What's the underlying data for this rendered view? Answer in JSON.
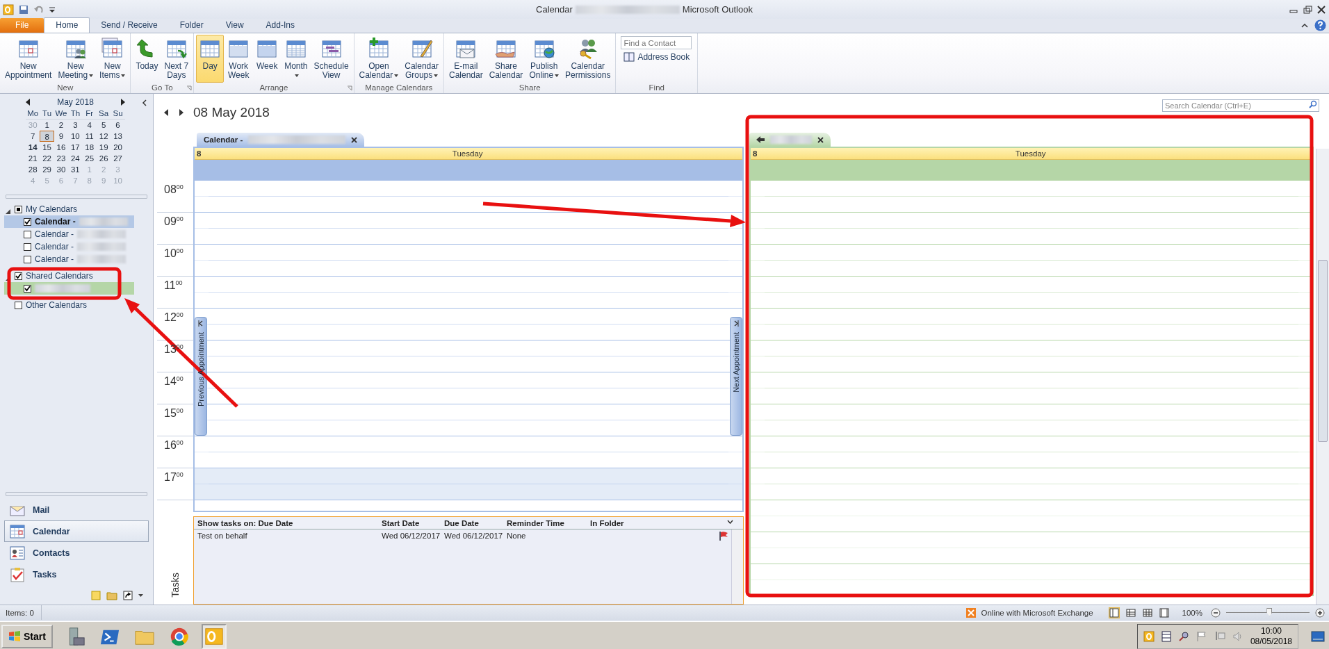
{
  "title_bar": {
    "title": "Calendar",
    "title_redacted": true,
    "app": "Microsoft Outlook"
  },
  "ribbon_tabs": [
    {
      "label": "File",
      "kind": "file",
      "selected": false
    },
    {
      "label": "Home",
      "kind": "tab",
      "selected": true
    },
    {
      "label": "Send / Receive",
      "kind": "tab",
      "selected": false
    },
    {
      "label": "Folder",
      "kind": "tab",
      "selected": false
    },
    {
      "label": "View",
      "kind": "tab",
      "selected": false
    },
    {
      "label": "Add-Ins",
      "kind": "tab",
      "selected": false
    }
  ],
  "ribbon_groups": [
    {
      "label": "New",
      "launcher": false,
      "buttons": [
        {
          "lines": [
            "New",
            "Appointment"
          ],
          "kind": "appointment",
          "menu": false,
          "selected": false
        },
        {
          "lines": [
            "New",
            "Meeting"
          ],
          "kind": "meeting",
          "menu": true,
          "selected": false
        },
        {
          "lines": [
            "New",
            "Items"
          ],
          "kind": "items",
          "menu": true,
          "selected": false
        }
      ]
    },
    {
      "label": "Go To",
      "launcher": true,
      "buttons": [
        {
          "lines": [
            "Today"
          ],
          "kind": "today",
          "menu": false,
          "selected": false
        },
        {
          "lines": [
            "Next 7",
            "Days"
          ],
          "kind": "next7",
          "menu": false,
          "selected": false
        }
      ]
    },
    {
      "label": "Arrange",
      "launcher": true,
      "buttons": [
        {
          "lines": [
            "Day"
          ],
          "kind": "day",
          "menu": false,
          "selected": true
        },
        {
          "lines": [
            "Work",
            "Week"
          ],
          "kind": "workweek",
          "menu": false,
          "selected": false
        },
        {
          "lines": [
            "Week"
          ],
          "kind": "week",
          "menu": false,
          "selected": false
        },
        {
          "lines": [
            "Month"
          ],
          "kind": "month",
          "menu": true,
          "selected": false
        },
        {
          "lines": [
            "Schedule",
            "View"
          ],
          "kind": "schedule",
          "menu": false,
          "selected": false
        }
      ]
    },
    {
      "label": "Manage Calendars",
      "launcher": false,
      "buttons": [
        {
          "lines": [
            "Open",
            "Calendar"
          ],
          "kind": "open",
          "menu": true,
          "selected": false
        },
        {
          "lines": [
            "Calendar",
            "Groups"
          ],
          "kind": "groups",
          "menu": true,
          "selected": false
        }
      ]
    },
    {
      "label": "Share",
      "launcher": false,
      "buttons": [
        {
          "lines": [
            "E-mail",
            "Calendar"
          ],
          "kind": "email",
          "menu": false,
          "selected": false
        },
        {
          "lines": [
            "Share",
            "Calendar"
          ],
          "kind": "share",
          "menu": false,
          "selected": false
        },
        {
          "lines": [
            "Publish",
            "Online"
          ],
          "kind": "publish",
          "menu": true,
          "selected": false
        },
        {
          "lines": [
            "Calendar",
            "Permissions"
          ],
          "kind": "permissions",
          "menu": false,
          "selected": false
        }
      ]
    },
    {
      "label": "Find",
      "launcher": false,
      "find": {
        "placeholder": "Find a Contact",
        "link": "Address Book"
      }
    }
  ],
  "mini_calendar": {
    "month": "May 2018",
    "weekdays": [
      "Mo",
      "Tu",
      "We",
      "Th",
      "Fr",
      "Sa",
      "Su"
    ],
    "weeks": [
      [
        {
          "day": "30",
          "other_month": true,
          "selected": false,
          "bold": false
        },
        {
          "day": "1",
          "other_month": false,
          "selected": false,
          "bold": false
        },
        {
          "day": "2",
          "other_month": false,
          "selected": false,
          "bold": false
        },
        {
          "day": "3",
          "other_month": false,
          "selected": false,
          "bold": false
        },
        {
          "day": "4",
          "other_month": false,
          "selected": false,
          "bold": false
        },
        {
          "day": "5",
          "other_month": false,
          "selected": false,
          "bold": false
        },
        {
          "day": "6",
          "other_month": false,
          "selected": false,
          "bold": false
        }
      ],
      [
        {
          "day": "7",
          "other_month": false,
          "selected": false,
          "bold": false
        },
        {
          "day": "8",
          "other_month": false,
          "selected": true,
          "bold": false
        },
        {
          "day": "9",
          "other_month": false,
          "selected": false,
          "bold": false
        },
        {
          "day": "10",
          "other_month": false,
          "selected": false,
          "bold": false
        },
        {
          "day": "11",
          "other_month": false,
          "selected": false,
          "bold": false
        },
        {
          "day": "12",
          "other_month": false,
          "selected": false,
          "bold": false
        },
        {
          "day": "13",
          "other_month": false,
          "selected": false,
          "bold": false
        }
      ],
      [
        {
          "day": "14",
          "other_month": false,
          "selected": false,
          "bold": true
        },
        {
          "day": "15",
          "other_month": false,
          "selected": false,
          "bold": false
        },
        {
          "day": "16",
          "other_month": false,
          "selected": false,
          "bold": false
        },
        {
          "day": "17",
          "other_month": false,
          "selected": false,
          "bold": false
        },
        {
          "day": "18",
          "other_month": false,
          "selected": false,
          "bold": false
        },
        {
          "day": "19",
          "other_month": false,
          "selected": false,
          "bold": false
        },
        {
          "day": "20",
          "other_month": false,
          "selected": false,
          "bold": false
        }
      ],
      [
        {
          "day": "21",
          "other_month": false,
          "selected": false,
          "bold": false
        },
        {
          "day": "22",
          "other_month": false,
          "selected": false,
          "bold": false
        },
        {
          "day": "23",
          "other_month": false,
          "selected": false,
          "bold": false
        },
        {
          "day": "24",
          "other_month": false,
          "selected": false,
          "bold": false
        },
        {
          "day": "25",
          "other_month": false,
          "selected": false,
          "bold": false
        },
        {
          "day": "26",
          "other_month": false,
          "selected": false,
          "bold": false
        },
        {
          "day": "27",
          "other_month": false,
          "selected": false,
          "bold": false
        }
      ],
      [
        {
          "day": "28",
          "other_month": false,
          "selected": false,
          "bold": false
        },
        {
          "day": "29",
          "other_month": false,
          "selected": false,
          "bold": false
        },
        {
          "day": "30",
          "other_month": false,
          "selected": false,
          "bold": false
        },
        {
          "day": "31",
          "other_month": false,
          "selected": false,
          "bold": false
        },
        {
          "day": "1",
          "other_month": true,
          "selected": false,
          "bold": false
        },
        {
          "day": "2",
          "other_month": true,
          "selected": false,
          "bold": false
        },
        {
          "day": "3",
          "other_month": true,
          "selected": false,
          "bold": false
        }
      ],
      [
        {
          "day": "4",
          "other_month": true,
          "selected": false,
          "bold": false
        },
        {
          "day": "5",
          "other_month": true,
          "selected": false,
          "bold": false
        },
        {
          "day": "6",
          "other_month": true,
          "selected": false,
          "bold": false
        },
        {
          "day": "7",
          "other_month": true,
          "selected": false,
          "bold": false
        },
        {
          "day": "8",
          "other_month": true,
          "selected": false,
          "bold": false
        },
        {
          "day": "9",
          "other_month": true,
          "selected": false,
          "bold": false
        },
        {
          "day": "10",
          "other_month": true,
          "selected": false,
          "bold": false
        }
      ]
    ]
  },
  "calendar_groups": [
    {
      "label": "My Calendars",
      "checked": true,
      "partial": true,
      "expanded": true,
      "children": [
        {
          "label": "Calendar -",
          "name_redacted": true,
          "checked": true,
          "color": "#b4c8e6"
        },
        {
          "label": "Calendar -",
          "name_redacted": true,
          "checked": false
        },
        {
          "label": "Calendar -",
          "name_redacted": true,
          "checked": false
        },
        {
          "label": "Calendar -",
          "name_redacted": true,
          "checked": false
        }
      ]
    },
    {
      "label": "Shared Calendars",
      "checked": true,
      "partial": false,
      "expanded": true,
      "children": [
        {
          "name_redacted": true,
          "checked": true,
          "color": "#b5d6a7"
        }
      ]
    },
    {
      "label": "Other Calendars",
      "checked": false,
      "partial": false,
      "expanded": false
    }
  ],
  "navigation": [
    {
      "label": "Mail",
      "kind": "mail",
      "selected": false
    },
    {
      "label": "Calendar",
      "kind": "calendar",
      "selected": true
    },
    {
      "label": "Contacts",
      "kind": "contacts",
      "selected": false
    },
    {
      "label": "Tasks",
      "kind": "tasks",
      "selected": false
    }
  ],
  "calendar": {
    "date_title": "08 May 2018",
    "search": {
      "placeholder": "Search Calendar (Ctrl+E)"
    },
    "hours": [
      {
        "label": "08$^{00}$",
        "work": true
      },
      {
        "label": "09$^{00}$",
        "work": true
      },
      {
        "label": "10$^{00}$",
        "work": true
      },
      {
        "label": "11$^{00}$",
        "work": true
      },
      {
        "label": "12$^{00}$",
        "work": true
      },
      {
        "label": "13$^{00}$",
        "work": true
      },
      {
        "label": "14$^{00}$",
        "work": true
      },
      {
        "label": "15$^{00}$",
        "work": true
      },
      {
        "label": "16$^{00}$",
        "work": true
      },
      {
        "label": "17$^{00}$",
        "work": false
      }
    ],
    "panes": [
      {
        "kind": "own",
        "tab": "Calendar -",
        "name_redacted": true,
        "day_number": "8",
        "day_name": "Tuesday",
        "color": "#a6bee6",
        "shade_off_hours": true,
        "previous": "Previous Appointment",
        "next": "Next Appointment"
      },
      {
        "kind": "overlay",
        "name_redacted": true,
        "day_number": "8",
        "day_name": "Tuesday",
        "color": "#b5d6a7",
        "shade_off_hours": false
      }
    ]
  },
  "tasks": {
    "title": "Tasks",
    "columns": [
      "Show tasks on: Due Date",
      "Start Date",
      "Due Date",
      "Reminder Time",
      "In Folder"
    ],
    "rows": [
      {
        "subject": "Test on behalf",
        "start": "Wed 06/12/2017",
        "due": "Wed 06/12/2017",
        "reminder": "None",
        "flagged": true
      }
    ]
  },
  "status_bar": {
    "items": "Items: 0",
    "connection": "Online with Microsoft Exchange",
    "zoom": "100%",
    "zoom_slider": {
      "level": 0.52
    },
    "views": [
      {
        "kind": "normal",
        "selected": true
      },
      {
        "kind": "grid",
        "selected": false
      },
      {
        "kind": "table",
        "selected": false
      },
      {
        "kind": "reading",
        "selected": false
      }
    ]
  },
  "taskbar": {
    "start": "Start",
    "apps": [
      {
        "kind": "server",
        "selected": false
      },
      {
        "kind": "powershell",
        "selected": false
      },
      {
        "kind": "explorer",
        "selected": false
      },
      {
        "kind": "chrome",
        "selected": false
      },
      {
        "kind": "outlook",
        "selected": true
      }
    ],
    "time": "10:00",
    "date": "08/05/2018"
  }
}
